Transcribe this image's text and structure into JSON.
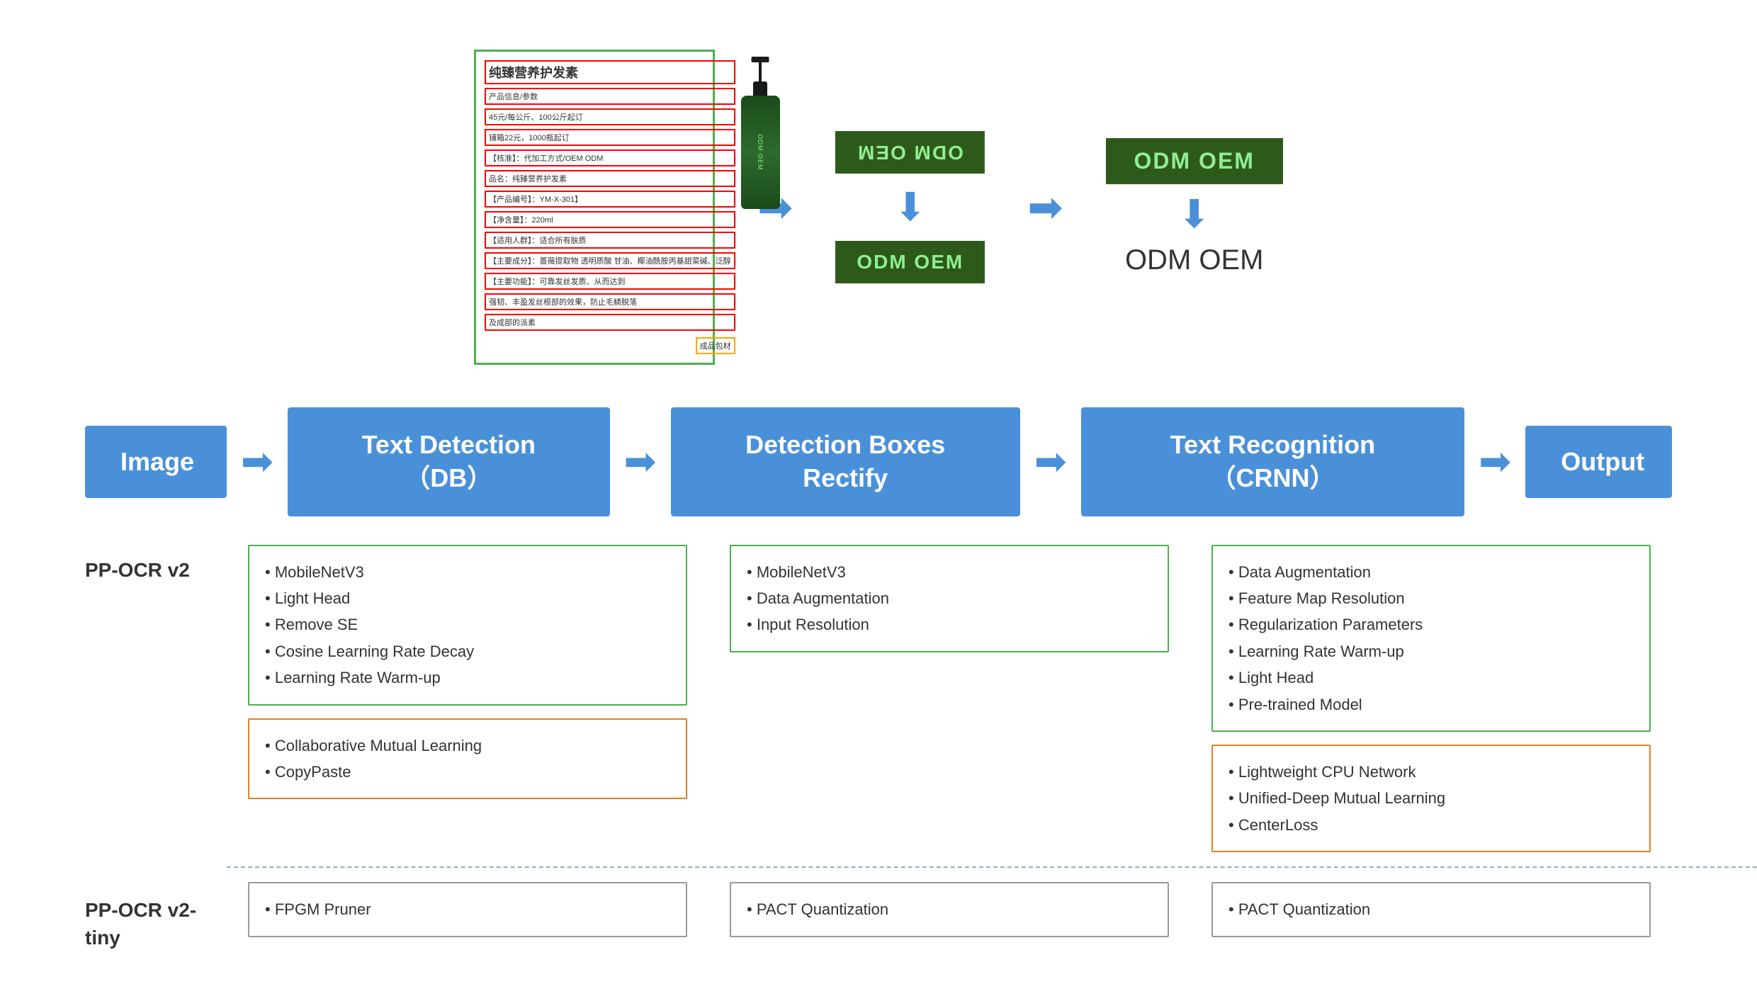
{
  "top": {
    "product": {
      "title": "纯臻营养护发素",
      "lines": [
        "产品信息/参数",
        "45元/每公斤、100公斤起订",
        "铺箱22元，1000瓶起订",
        "【核准】：代加工方式/OEM ODM",
        "品名：纯臻营养护发素",
        "【产品编号】：YM-X-301】",
        "【净含量】：220ml",
        "【适用人群】：适合所有肤质",
        "【主要成分】：蔷薇提取物、透明质酸、甘油、椰油酰胺丙基甜菜碱、泛醇",
        "【主要功能】：可靠发丝发质、从而达到",
        "强韧、丰盈发丝根部的效果，防止毛鳞脱落",
        "及成部的派素"
      ],
      "orange_line": "成品包材"
    },
    "odm_boxes_middle": {
      "top": "ODM OEM",
      "bottom": "ODM OEM"
    },
    "odm_right": {
      "box": "ODM OEM",
      "text": "ODM OEM"
    }
  },
  "flow": {
    "boxes": [
      {
        "id": "image",
        "label": "Image"
      },
      {
        "id": "text-detection",
        "label": "Text Detection（DB）"
      },
      {
        "id": "detection-boxes",
        "label": "Detection Boxes Rectify"
      },
      {
        "id": "text-recognition",
        "label": "Text Recognition（CRNN）"
      },
      {
        "id": "output",
        "label": "Output"
      }
    ]
  },
  "pp_ocr_v2": {
    "label": "PP-OCR v2",
    "detection_green": [
      "MobileNetV3",
      "Light Head",
      "Remove SE",
      "Cosine Learning Rate Decay",
      "Learning Rate Warm-up"
    ],
    "detection_orange": [
      "Collaborative Mutual Learning",
      "CopyPaste"
    ],
    "rectify_green": [
      "MobileNetV3",
      "Data Augmentation",
      "Input Resolution"
    ],
    "recognition_green": [
      "Data Augmentation",
      "Feature Map Resolution",
      "Regularization Parameters",
      "Learning Rate Warm-up",
      "Light Head",
      "Pre-trained Model"
    ],
    "recognition_orange": [
      "Lightweight CPU Network",
      "Unified-Deep Mutual Learning",
      "CenterLoss"
    ]
  },
  "pp_ocr_v2_tiny": {
    "label": "PP-OCR v2-tiny",
    "detection_gray": [
      "FPGM Pruner"
    ],
    "rectify_gray": [
      "PACT Quantization"
    ],
    "recognition_gray": [
      "PACT Quantization"
    ]
  }
}
